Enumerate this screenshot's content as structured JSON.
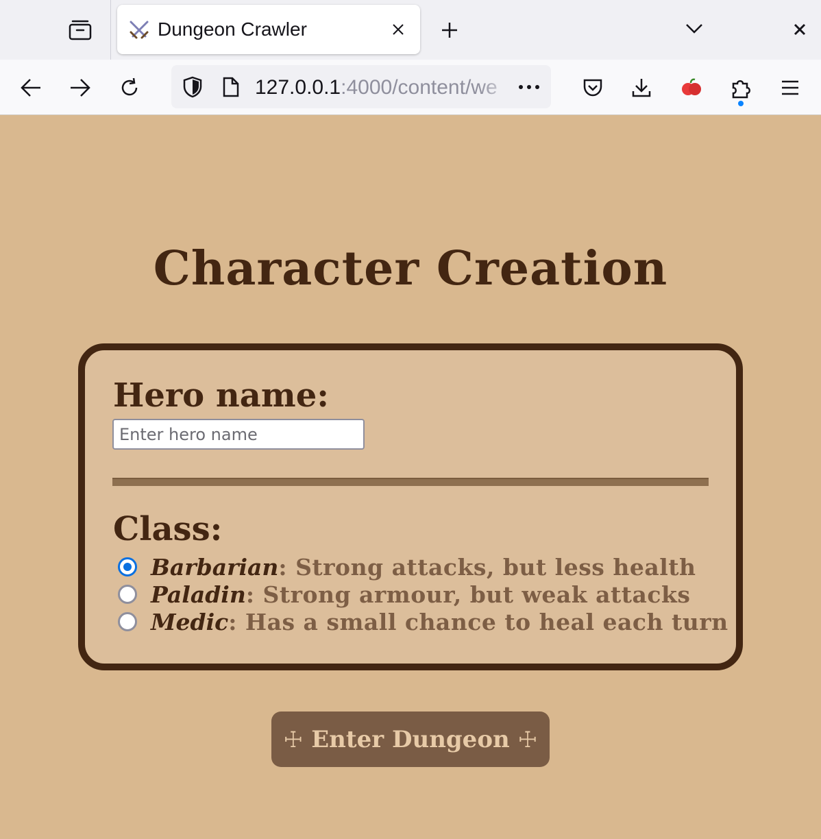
{
  "browser": {
    "tab_title": "Dungeon Crawler",
    "url_host": "127.0.0.1",
    "url_rest": ":4000/content/we"
  },
  "page": {
    "title": "Character Creation",
    "hero_label": "Hero name:",
    "hero_placeholder": "Enter hero name",
    "hero_value": "",
    "class_label": "Class:",
    "classes": [
      {
        "name": "Barbarian",
        "description": ": Strong attacks, but less health",
        "selected": true
      },
      {
        "name": "Paladin",
        "description": ": Strong armour, but weak attacks",
        "selected": false
      },
      {
        "name": "Medic",
        "description": ": Has a small chance to heal each turn",
        "selected": false
      }
    ],
    "enter_cross": "☩",
    "enter_label": "Enter Dungeon"
  },
  "colors": {
    "background": "#d9b88f",
    "panel": "#dcbe9b",
    "dark_brown": "#432612",
    "button": "#7a5c45",
    "radio_accent": "#0a70e0"
  }
}
